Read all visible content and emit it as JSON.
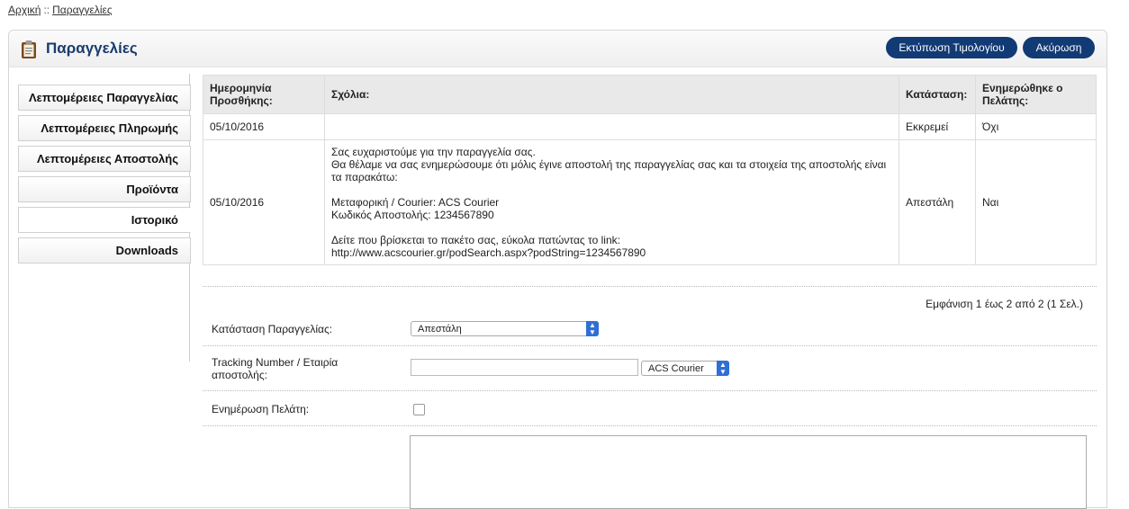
{
  "breadcrumb": {
    "home": "Αρχική",
    "separator": "::",
    "current": "Παραγγελίες"
  },
  "header": {
    "title": "Παραγγελίες",
    "icon": "clipboard-icon",
    "print_invoice_label": "Εκτύπωση Τιμολογίου",
    "cancel_label": "Ακύρωση"
  },
  "sidebar": {
    "items": [
      {
        "label": "Λεπτομέρειες Παραγγελίας"
      },
      {
        "label": "Λεπτομέρειες Πληρωμής"
      },
      {
        "label": "Λεπτομέρειες Αποστολής"
      },
      {
        "label": "Προϊόντα"
      },
      {
        "label": "Ιστορικό"
      },
      {
        "label": "Downloads"
      }
    ],
    "active": "Ιστορικό"
  },
  "history_table": {
    "headers": [
      "Ημερομηνία Προσθήκης:",
      "Σχόλια:",
      "Κατάσταση:",
      "Ενημερώθηκε ο Πελάτης:"
    ],
    "rows": [
      {
        "date": "05/10/2016",
        "comment": [],
        "status": "Εκκρεμεί",
        "notified": "Όχι"
      },
      {
        "date": "05/10/2016",
        "comment": [
          "Σας ευχαριστούμε για την παραγγελία σας.",
          "Θα θέλαμε να σας ενημερώσουμε ότι μόλις έγινε αποστολή της παραγγελίας σας και τα στοιχεία της αποστολής είναι τα παρακάτω:",
          "",
          "Μεταφορική / Courier: ACS Courier",
          "Κωδικός Αποστολής: 1234567890",
          "",
          "Δείτε που βρίσκεται το πακέτο σας, εύκολα πατώντας το link:",
          "http://www.acscourier.gr/podSearch.aspx?podString=1234567890"
        ],
        "status": "Απεστάλη",
        "notified": "Ναι"
      }
    ]
  },
  "pagination": {
    "text": "Εμφάνιση 1 έως 2 από 2 (1 Σελ.)"
  },
  "form": {
    "order_status_label": "Κατάσταση Παραγγελίας:",
    "order_status_value": "Απεστάλη",
    "tracking_label": "Tracking Number / Εταιρία αποστολής:",
    "tracking_value": "",
    "courier_value": "ACS Courier",
    "notify_label": "Ενημέρωση Πελάτη:",
    "notify_checked": false,
    "comment_value": ""
  }
}
